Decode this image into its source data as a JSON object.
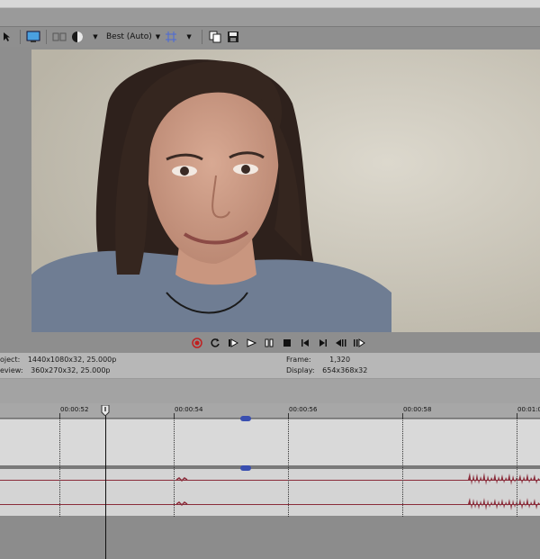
{
  "toolbar": {
    "quality_label": "Best (Auto)"
  },
  "transport": {
    "buttons": [
      "record",
      "loop",
      "play-from-start",
      "play",
      "pause",
      "stop",
      "prev-frame",
      "next-frame",
      "prev-marker",
      "next-marker"
    ]
  },
  "info": {
    "project_label": "oject:",
    "project_value": "1440x1080x32, 25.000p",
    "preview_label": "eview:",
    "preview_value": "360x270x32, 25.000p",
    "frame_label": "Frame:",
    "frame_value": "1,320",
    "display_label": "Display:",
    "display_value": "654x368x32"
  },
  "timeline": {
    "ticks": [
      "00:00:52",
      "00:00:54",
      "00:00:56",
      "00:00:58",
      "00:01:0"
    ]
  },
  "colors": {
    "audio_waveform": "#8a2c3a",
    "marker": "#3a4fb0"
  }
}
